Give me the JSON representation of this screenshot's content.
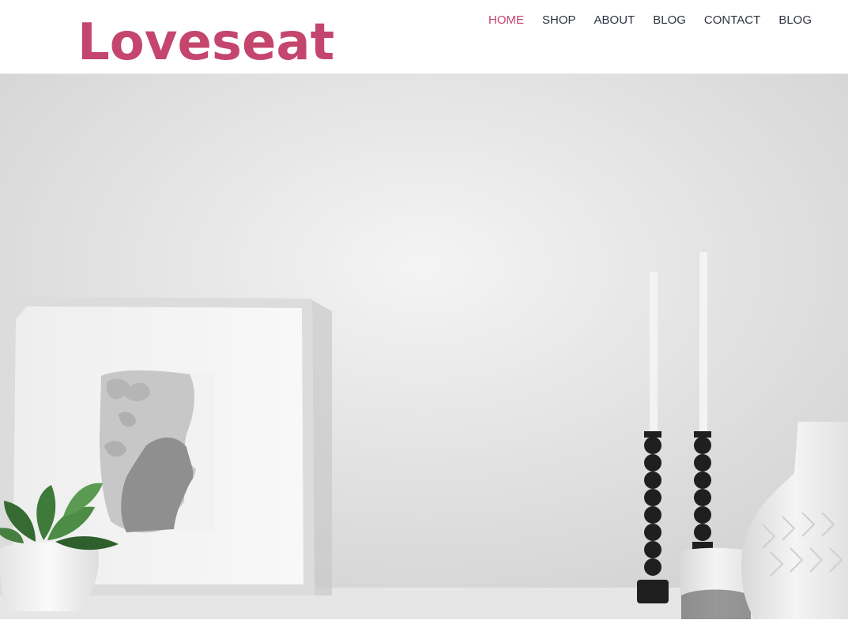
{
  "site": {
    "logo": "Loveseat"
  },
  "nav": {
    "items": [
      {
        "label": "HOME",
        "active": true
      },
      {
        "label": "SHOP",
        "active": false
      },
      {
        "label": "ABOUT",
        "active": false
      },
      {
        "label": "BLOG",
        "active": false
      },
      {
        "label": "CONTACT",
        "active": false
      },
      {
        "label": "BLOG",
        "active": false
      }
    ]
  },
  "colors": {
    "brand": "#c4456d",
    "nav_text": "#2f3340"
  },
  "hero": {
    "image": "framed-portrait-plant-candlesticks-vase"
  }
}
